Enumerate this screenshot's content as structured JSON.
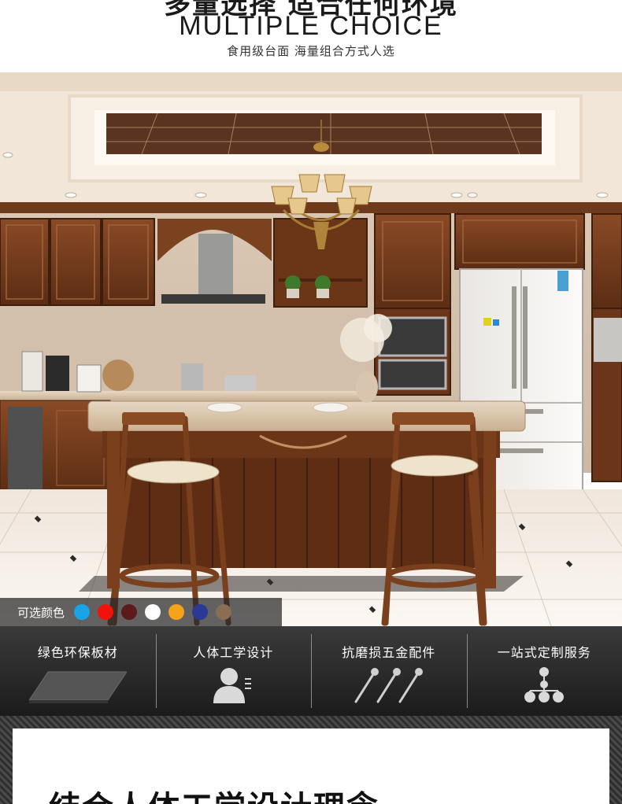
{
  "header": {
    "title_cn": "多量选择 适合任何环境",
    "title_en": "MULTIPLE CHOICE",
    "subtitle": "食用级台面  海量组合方式人选"
  },
  "color_options": {
    "label": "可选颜色",
    "swatches": [
      "#1aa3e6",
      "#f2120c",
      "#5c1a1a",
      "#ffffff",
      "#f6a21a",
      "#2a3a94",
      "#8a6d55"
    ]
  },
  "features": [
    {
      "label": "绿色环保板材",
      "icon": "board-icon"
    },
    {
      "label": "人体工学设计",
      "icon": "person-icon"
    },
    {
      "label": "抗磨损五金配件",
      "icon": "screws-icon"
    },
    {
      "label": "一站式定制服务",
      "icon": "org-chart-icon"
    }
  ],
  "panel": {
    "title": "结合人体工学设计理念"
  }
}
